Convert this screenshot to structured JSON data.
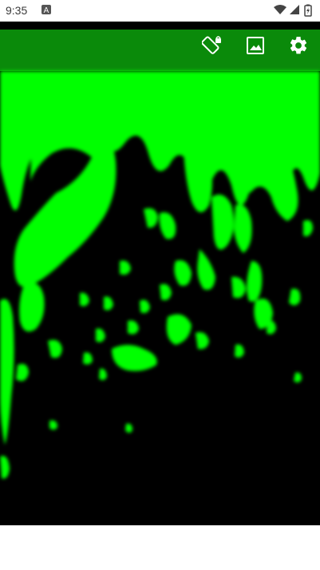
{
  "status_bar": {
    "time": "9:35",
    "icons": [
      "notification-a-icon",
      "wifi-icon",
      "signal-icon",
      "battery-charging-icon"
    ]
  },
  "toolbar": {
    "icons": [
      "rotation-lock-icon",
      "image-icon",
      "gear-icon"
    ]
  },
  "colors": {
    "background": "#000000",
    "slime": "#00ff00",
    "slime_dark": "#0a8a0a",
    "status_bar": "#ffffff"
  }
}
